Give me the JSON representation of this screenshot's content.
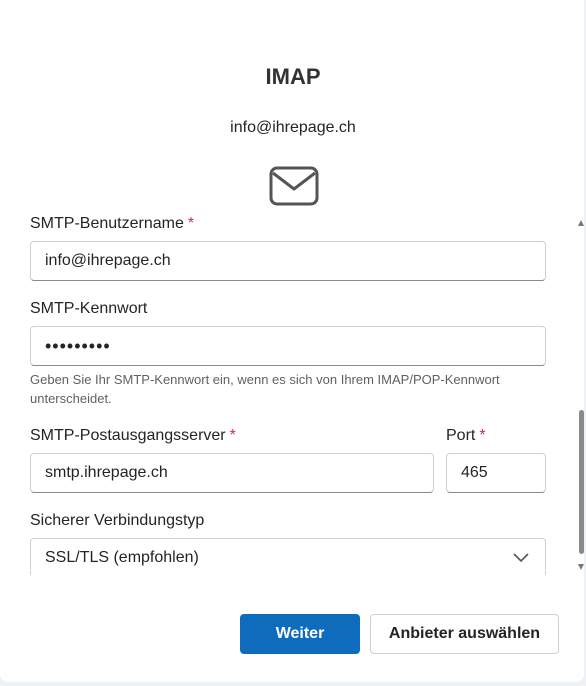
{
  "dialog": {
    "title": "IMAP",
    "account_email": "info@ihrepage.ch"
  },
  "form": {
    "smtp_username": {
      "label": "SMTP-Benutzername",
      "required_mark": "*",
      "value": "info@ihrepage.ch"
    },
    "smtp_password": {
      "label": "SMTP-Kennwort",
      "value": "•••••••••",
      "hint": "Geben Sie Ihr SMTP-Kennwort ein, wenn es sich von Ihrem IMAP/POP-Kennwort unterscheidet."
    },
    "smtp_server": {
      "label": "SMTP-Postausgangsserver",
      "required_mark": "*",
      "value": "smtp.ihrepage.ch"
    },
    "port": {
      "label": "Port",
      "required_mark": "*",
      "value": "465"
    },
    "connection_type": {
      "label": "Sicherer Verbindungstyp",
      "selected": "SSL/TLS (empfohlen)"
    }
  },
  "buttons": {
    "next": "Weiter",
    "choose_provider": "Anbieter auswählen"
  },
  "icons": {
    "mail": "envelope-icon",
    "chevron": "chevron-down-icon"
  },
  "colors": {
    "primary": "#0f6cbd",
    "required": "#c4314b"
  }
}
